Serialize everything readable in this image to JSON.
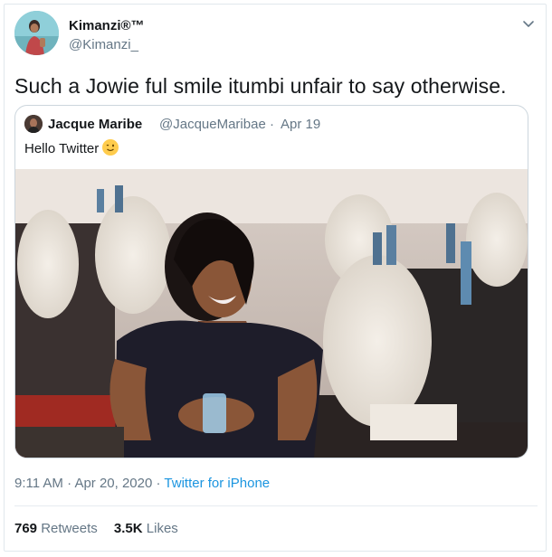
{
  "author": {
    "name": "Kimanzi®™",
    "handle": "@Kimanzi_",
    "avatar_icon": "user-avatar"
  },
  "tweet": {
    "text": "Such a Jowie ful smile itumbi unfair to say otherwise.",
    "menu_icon": "chevron-down-icon"
  },
  "quoted_tweet": {
    "name": "Jacque Maribe",
    "handle": "@JacqueMaribae",
    "separator": "·",
    "date": "Apr 19",
    "text": "Hello Twitter",
    "emoji": "winking-face",
    "image_icon": "event-photo"
  },
  "meta": {
    "time": "9:11 AM",
    "separator1": "·",
    "date": "Apr 20, 2020",
    "separator2": "·",
    "source": "Twitter for iPhone"
  },
  "stats": {
    "retweets_count": "769",
    "retweets_label": "Retweets",
    "likes_count": "3.5K",
    "likes_label": "Likes"
  },
  "colors": {
    "text": "#14171a",
    "secondary": "#657786",
    "link": "#1b95e0",
    "border": "#e1e8ed"
  }
}
